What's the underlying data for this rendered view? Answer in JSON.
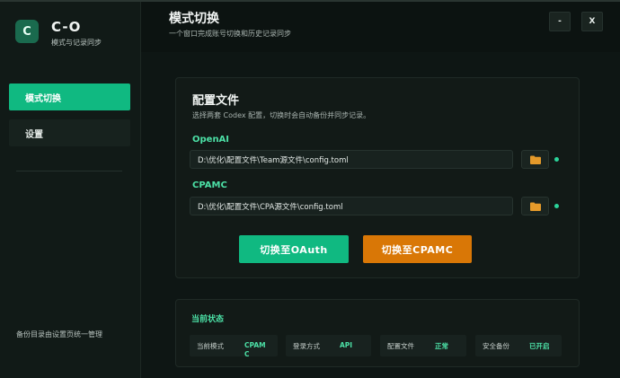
{
  "app": {
    "logo_letter": "C",
    "title": "C-O",
    "subtitle": "模式与记录同步"
  },
  "sidebar": {
    "items": [
      {
        "label": "模式切换",
        "active": true
      },
      {
        "label": "设置",
        "active": false
      }
    ],
    "footer": "备份目录由设置页统一管理"
  },
  "header": {
    "title": "模式切换",
    "subtitle": "一个窗口完成账号切换和历史记录同步",
    "minimize_label": "-",
    "close_label": "X"
  },
  "config": {
    "title": "配置文件",
    "description": "选择两套 Codex 配置，切换时会自动备份并同步记录。",
    "providers": [
      {
        "label": "OpenAI",
        "path": "D:\\优化\\配置文件\\Team源文件\\config.toml",
        "status": "ok"
      },
      {
        "label": "CPAMC",
        "path": "D:\\优化\\配置文件\\CPA源文件\\config.toml",
        "status": "ok"
      }
    ],
    "switch_oauth_label": "切换至OAuth",
    "switch_cpamc_label": "切换至CPAMC"
  },
  "status": {
    "title": "当前状态",
    "items": [
      {
        "key": "当前模式",
        "value": "CPAM C"
      },
      {
        "key": "登录方式",
        "value": "API"
      },
      {
        "key": "配置文件",
        "value": "正常"
      },
      {
        "key": "安全备份",
        "value": "已开启"
      }
    ]
  },
  "colors": {
    "accent_green": "#10b981",
    "accent_orange": "#d97706",
    "label_green": "#4ce0a6",
    "folder_icon": "#e59a2a"
  },
  "icons": {
    "folder": "folder-icon",
    "status_dot": "status-dot-icon"
  }
}
